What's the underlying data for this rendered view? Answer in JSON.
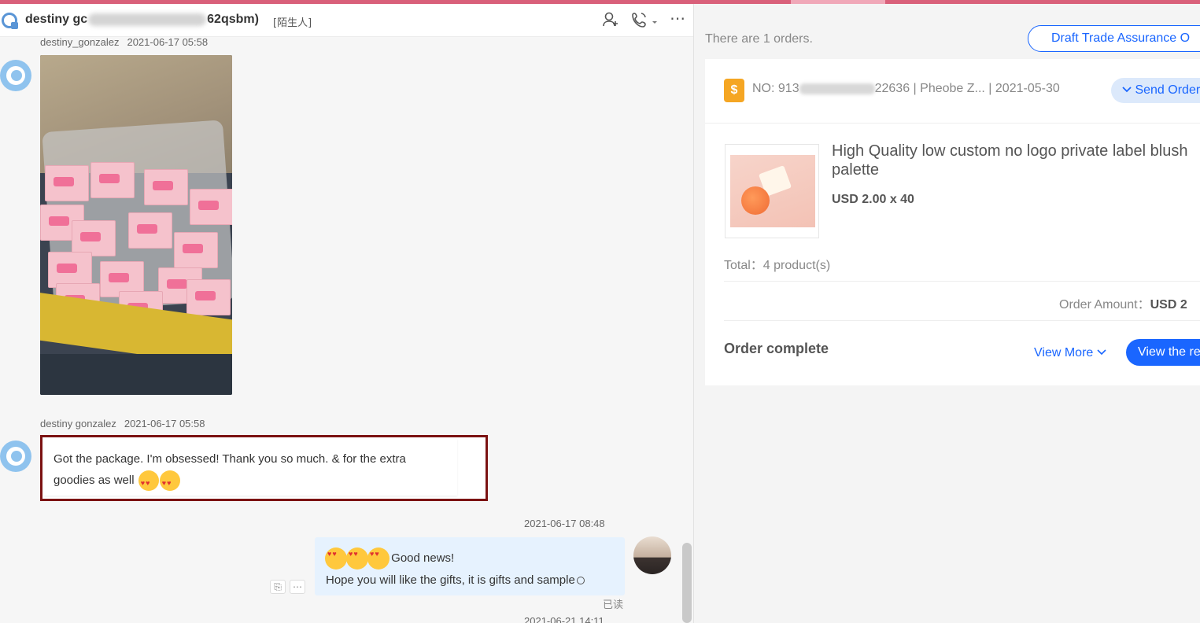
{
  "header": {
    "name": "destiny gc",
    "id_suffix": "62qsbm)",
    "tag": "[陌生人]",
    "icons": [
      "add-contact-icon",
      "call-icon",
      "more-icon"
    ]
  },
  "messages": {
    "m1": {
      "sender": "destiny_gonzalez",
      "time": "2021-06-17 05:58"
    },
    "m2": {
      "sender": "destiny gonzalez",
      "time": "2021-06-17 05:58",
      "text": "Got the package. I'm obsessed! Thank you so much. & for the extra goodies as well"
    },
    "m3": {
      "time": "2021-06-17 08:48",
      "line1": "Good news!",
      "line2": "Hope you will like the gifts, it is gifts and sample",
      "read": "已读"
    },
    "m4": {
      "time": "2021-06-21 14:11"
    },
    "tools": {
      "translate": "⎘",
      "more": "⋯"
    }
  },
  "orders": {
    "count_text": "There are 1 orders.",
    "draft_button": "Draft Trade Assurance O",
    "order": {
      "no_prefix": "NO: 913",
      "no_suffix": "22636",
      "buyer": "Pheobe Z...",
      "date": "2021-05-30",
      "send_button": "Send Order",
      "product_title": "High Quality low custom no logo private label blush palette",
      "price": "USD 2.00 x 40",
      "total": "Total：4 product(s)",
      "amount_label": "Order Amount：",
      "amount_value": "USD 2",
      "status": "Order complete",
      "view_more": "View More",
      "view_button": "View the re"
    }
  }
}
